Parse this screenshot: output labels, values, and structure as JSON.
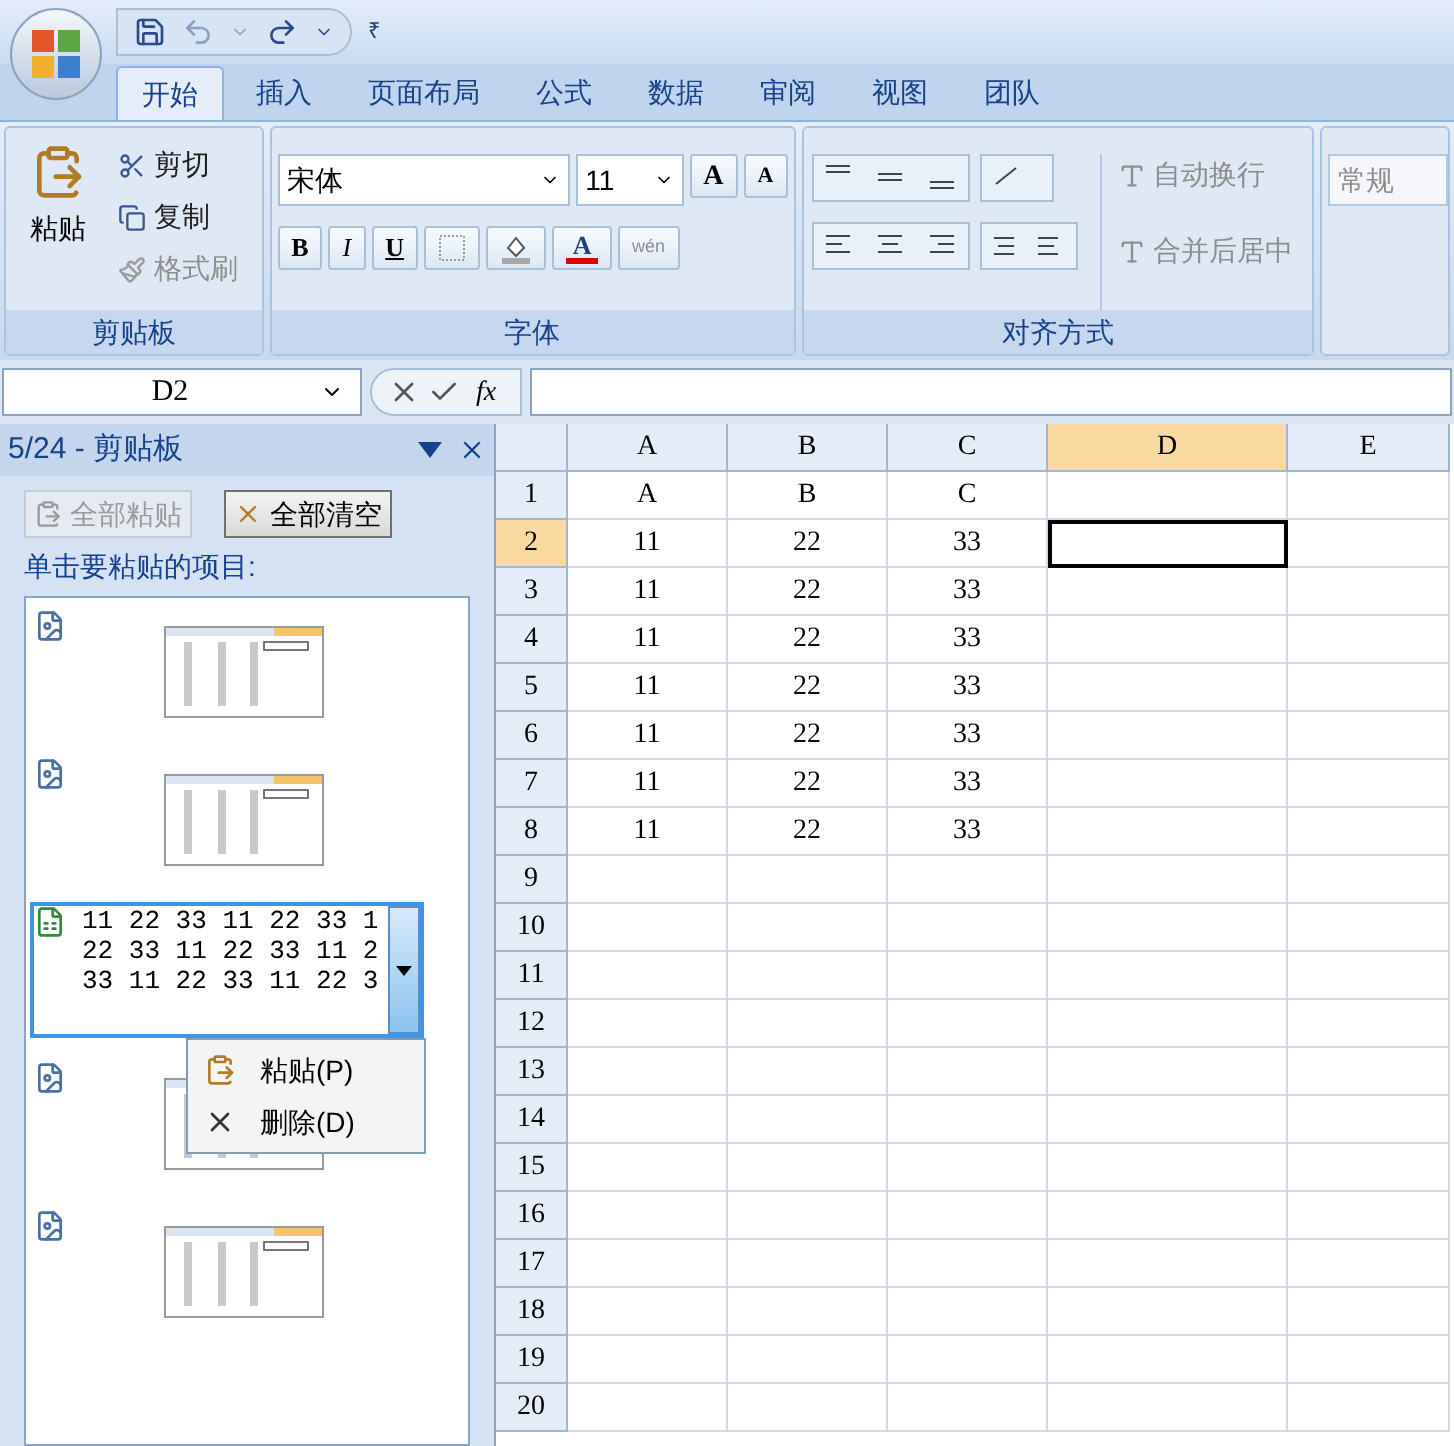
{
  "quick_access": {
    "more": "₹"
  },
  "tabs": [
    {
      "label": "开始",
      "selected": true
    },
    {
      "label": "插入",
      "selected": false
    },
    {
      "label": "页面布局",
      "selected": false
    },
    {
      "label": "公式",
      "selected": false
    },
    {
      "label": "数据",
      "selected": false
    },
    {
      "label": "审阅",
      "selected": false
    },
    {
      "label": "视图",
      "selected": false
    },
    {
      "label": "团队",
      "selected": false
    }
  ],
  "clipboard_group": {
    "title": "剪贴板",
    "paste": "粘贴",
    "items": [
      {
        "label": "剪切",
        "disabled": false
      },
      {
        "label": "复制",
        "disabled": false
      },
      {
        "label": "格式刷",
        "disabled": true
      }
    ]
  },
  "font_group": {
    "title": "字体",
    "font_name": "宋体",
    "font_size": "11",
    "grow": "A",
    "shrink": "A",
    "bold": "B",
    "italic": "I",
    "underline": "U",
    "font_color": "A",
    "phonetic": "wén"
  },
  "alignment_group": {
    "title": "对齐方式",
    "wrap": "自动换行",
    "merge": "合并后居中"
  },
  "number_group": {
    "format": "常规"
  },
  "formula_bar": {
    "name_box": "D2",
    "fx": "fx"
  },
  "clipboard_pane": {
    "title": "5/24 - 剪贴板",
    "paste_all": {
      "label": "全部粘贴",
      "disabled": true
    },
    "clear_all": {
      "label": "全部清空",
      "disabled": false
    },
    "prompt": "单击要粘贴的项目:",
    "items": [
      {
        "kind": "picture",
        "selected": false
      },
      {
        "kind": "picture",
        "selected": false
      },
      {
        "kind": "text",
        "selected": true,
        "lines": [
          "11 22 33 11 22 33 1",
          "22 33 11 22 33 11 2",
          "33 11 22 33 11 22 3"
        ]
      },
      {
        "kind": "picture",
        "selected": false
      },
      {
        "kind": "picture",
        "selected": false
      }
    ],
    "menu": [
      {
        "label": "粘贴(P)"
      },
      {
        "label": "删除(D)"
      }
    ]
  },
  "sheet": {
    "columns": [
      {
        "label": "A",
        "selected": false
      },
      {
        "label": "B",
        "selected": false
      },
      {
        "label": "C",
        "selected": false
      },
      {
        "label": "D",
        "selected": true
      },
      {
        "label": "E",
        "selected": false
      }
    ],
    "rows": [
      {
        "label": "1",
        "selected": false,
        "cells": [
          "A",
          "B",
          "C",
          "",
          ""
        ]
      },
      {
        "label": "2",
        "selected": true,
        "cells": [
          "11",
          "22",
          "33",
          "",
          ""
        ]
      },
      {
        "label": "3",
        "selected": false,
        "cells": [
          "11",
          "22",
          "33",
          "",
          ""
        ]
      },
      {
        "label": "4",
        "selected": false,
        "cells": [
          "11",
          "22",
          "33",
          "",
          ""
        ]
      },
      {
        "label": "5",
        "selected": false,
        "cells": [
          "11",
          "22",
          "33",
          "",
          ""
        ]
      },
      {
        "label": "6",
        "selected": false,
        "cells": [
          "11",
          "22",
          "33",
          "",
          ""
        ]
      },
      {
        "label": "7",
        "selected": false,
        "cells": [
          "11",
          "22",
          "33",
          "",
          ""
        ]
      },
      {
        "label": "8",
        "selected": false,
        "cells": [
          "11",
          "22",
          "33",
          "",
          ""
        ]
      },
      {
        "label": "9",
        "selected": false,
        "cells": [
          "",
          "",
          "",
          "",
          ""
        ]
      },
      {
        "label": "10",
        "selected": false,
        "cells": [
          "",
          "",
          "",
          "",
          ""
        ]
      },
      {
        "label": "11",
        "selected": false,
        "cells": [
          "",
          "",
          "",
          "",
          ""
        ]
      },
      {
        "label": "12",
        "selected": false,
        "cells": [
          "",
          "",
          "",
          "",
          ""
        ]
      },
      {
        "label": "13",
        "selected": false,
        "cells": [
          "",
          "",
          "",
          "",
          ""
        ]
      },
      {
        "label": "14",
        "selected": false,
        "cells": [
          "",
          "",
          "",
          "",
          ""
        ]
      },
      {
        "label": "15",
        "selected": false,
        "cells": [
          "",
          "",
          "",
          "",
          ""
        ]
      },
      {
        "label": "16",
        "selected": false,
        "cells": [
          "",
          "",
          "",
          "",
          ""
        ]
      },
      {
        "label": "17",
        "selected": false,
        "cells": [
          "",
          "",
          "",
          "",
          ""
        ]
      },
      {
        "label": "18",
        "selected": false,
        "cells": [
          "",
          "",
          "",
          "",
          ""
        ]
      },
      {
        "label": "19",
        "selected": false,
        "cells": [
          "",
          "",
          "",
          "",
          ""
        ]
      },
      {
        "label": "20",
        "selected": false,
        "cells": [
          "",
          "",
          "",
          "",
          ""
        ]
      }
    ]
  }
}
